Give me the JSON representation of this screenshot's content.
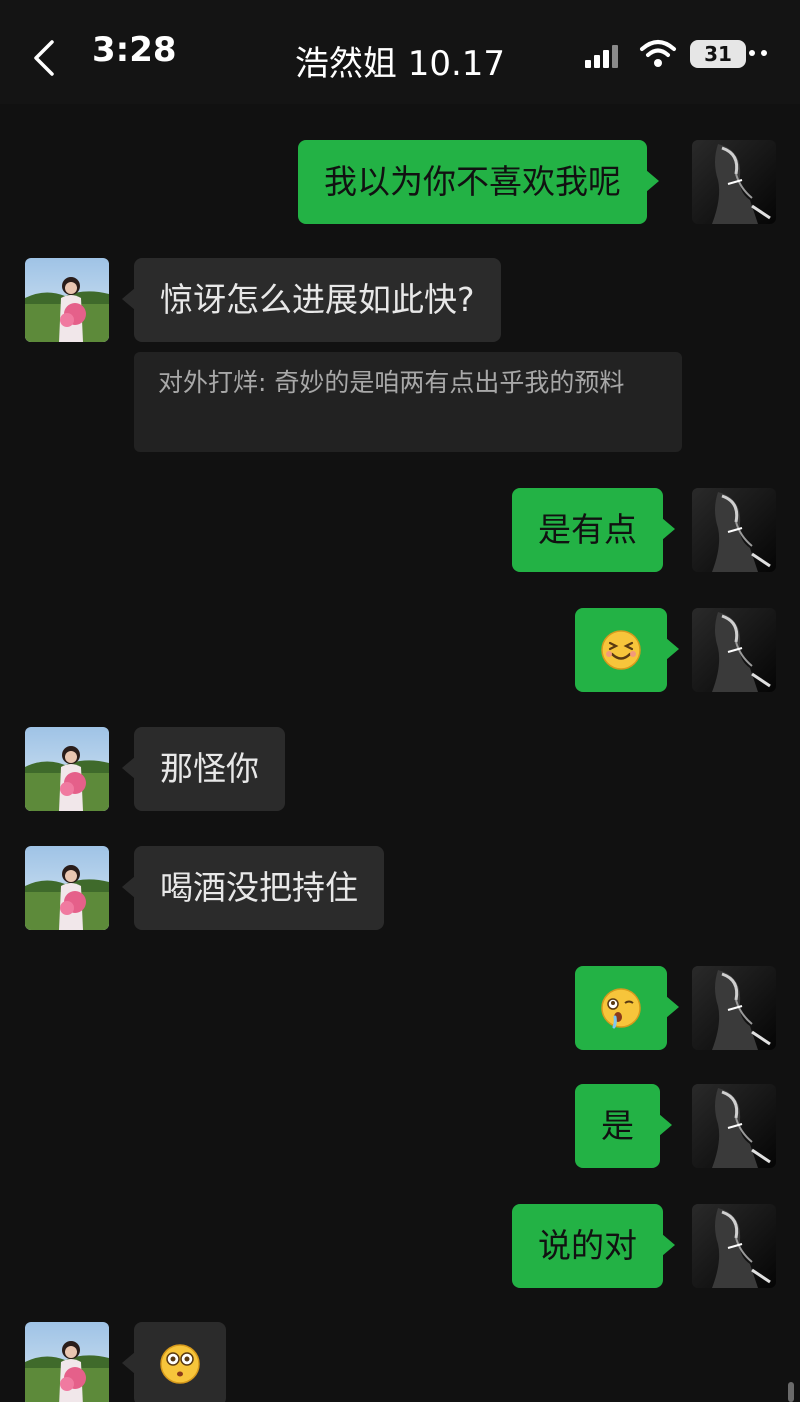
{
  "status_bar": {
    "time": "3:28",
    "battery": "31"
  },
  "chat": {
    "title": "浩然姐 10.17"
  },
  "messages": [
    {
      "side": "out",
      "text": "我以为你不喜欢我呢"
    },
    {
      "side": "in",
      "text": "惊讶怎么进展如此快?"
    },
    {
      "side": "in-quote",
      "text": "对外打烊: 奇妙的是咱两有点出乎我的预料"
    },
    {
      "side": "out",
      "text": "是有点"
    },
    {
      "side": "out",
      "emoji": "grinning-squint-emoji"
    },
    {
      "side": "in",
      "text": "那怪你"
    },
    {
      "side": "in",
      "text": "喝酒没把持住"
    },
    {
      "side": "out",
      "emoji": "drooling-face-emoji"
    },
    {
      "side": "out",
      "text": "是"
    },
    {
      "side": "out",
      "text": "说的对"
    },
    {
      "side": "in",
      "emoji": "flushed-face-emoji"
    }
  ],
  "colors": {
    "background": "#111111",
    "outgoing_bubble": "#23b245",
    "incoming_bubble": "#2b2b2b"
  }
}
